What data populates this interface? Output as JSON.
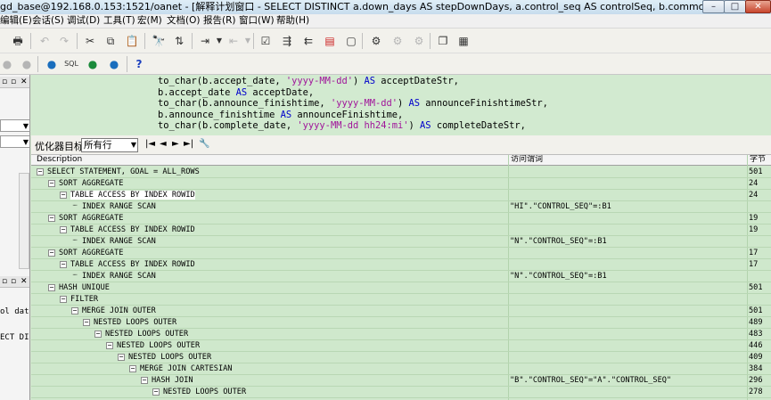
{
  "window": {
    "title": "gd_base@192.168.0.153:1521/oanet - [解释计划窗口 - SELECT DISTINCT a.down_days AS stepDownDays, a.control_seq AS controlSeq, b.common_code, to_ch]",
    "minimize": "–",
    "maximize": "□",
    "close": "✕"
  },
  "menu": [
    "编辑(E)",
    "会话(S)",
    "调试(D)",
    "工具(T)",
    "宏(M)",
    "文档(O)",
    "报告(R)",
    "窗口(W)",
    "帮助(H)"
  ],
  "icons": {
    "toolbar1": [
      "print-icon",
      "undo-icon",
      "redo-icon",
      "cut-icon",
      "copy-icon",
      "paste-icon",
      "find-icon",
      "replace-icon",
      "import-icon",
      "export-icon",
      "describe-icon",
      "indent-icon",
      "unindent-icon",
      "comment-icon",
      "uncomment-icon",
      "debug-icon",
      "step-icon",
      "step-over-icon",
      "window-icon",
      "tile-icon"
    ],
    "toolbar2": [
      "connect-icon",
      "disconnect-icon",
      "session-icon",
      "sql-icon",
      "commit-icon",
      "rollback-icon",
      "help-icon"
    ]
  },
  "left_panel": {
    "combo1": "",
    "combo2": "",
    "text1": "ol date:",
    "text2": "ECT DISTI"
  },
  "sql": [
    [
      {
        "t": "to_char(b.accept_date, ",
        "c": "plain"
      },
      {
        "t": "'yyyy-MM-dd'",
        "c": "str"
      },
      {
        "t": ") ",
        "c": "plain"
      },
      {
        "t": "AS",
        "c": "kw"
      },
      {
        "t": " acceptDateStr,",
        "c": "plain"
      }
    ],
    [
      {
        "t": "b.accept_date ",
        "c": "plain"
      },
      {
        "t": "AS",
        "c": "kw"
      },
      {
        "t": " acceptDate,",
        "c": "plain"
      }
    ],
    [
      {
        "t": "to_char(b.announce_finishtime, ",
        "c": "plain"
      },
      {
        "t": "'yyyy-MM-dd'",
        "c": "str"
      },
      {
        "t": ") ",
        "c": "plain"
      },
      {
        "t": "AS",
        "c": "kw"
      },
      {
        "t": " announceFinishtimeStr,",
        "c": "plain"
      }
    ],
    [
      {
        "t": "b.announce_finishtime ",
        "c": "plain"
      },
      {
        "t": "AS",
        "c": "kw"
      },
      {
        "t": " announceFinishtime,",
        "c": "plain"
      }
    ],
    [
      {
        "t": "to_char(b.complete_date, ",
        "c": "plain"
      },
      {
        "t": "'yyyy-MM-dd hh24:mi'",
        "c": "str"
      },
      {
        "t": ") ",
        "c": "plain"
      },
      {
        "t": "AS",
        "c": "kw"
      },
      {
        "t": " completeDateStr,",
        "c": "plain"
      }
    ]
  ],
  "optimizer": {
    "label": "优化器目标",
    "value": "所有行",
    "nav": [
      "|◄",
      "◄",
      "►",
      "►|",
      "🔧"
    ]
  },
  "grid": {
    "columns": [
      "Description",
      "访问谓词",
      "字节"
    ],
    "rows": [
      {
        "depth": 0,
        "desc": "SELECT STATEMENT, GOAL = ALL_ROWS",
        "pred": "",
        "bytes": "501",
        "node": "minus"
      },
      {
        "depth": 1,
        "desc": "SORT AGGREGATE",
        "pred": "",
        "bytes": "24",
        "node": "minus"
      },
      {
        "depth": 2,
        "desc": "TABLE ACCESS BY INDEX ROWID",
        "pred": "",
        "bytes": "24",
        "node": "minus",
        "selected": true
      },
      {
        "depth": 3,
        "desc": "INDEX RANGE SCAN",
        "pred": "\"HI\".\"CONTROL_SEQ\"=:B1",
        "bytes": "",
        "node": "leaf"
      },
      {
        "depth": 1,
        "desc": "SORT AGGREGATE",
        "pred": "",
        "bytes": "19",
        "node": "minus"
      },
      {
        "depth": 2,
        "desc": "TABLE ACCESS BY INDEX ROWID",
        "pred": "",
        "bytes": "19",
        "node": "minus"
      },
      {
        "depth": 3,
        "desc": "INDEX RANGE SCAN",
        "pred": "\"N\".\"CONTROL_SEQ\"=:B1",
        "bytes": "",
        "node": "leaf"
      },
      {
        "depth": 1,
        "desc": "SORT AGGREGATE",
        "pred": "",
        "bytes": "17",
        "node": "minus"
      },
      {
        "depth": 2,
        "desc": "TABLE ACCESS BY INDEX ROWID",
        "pred": "",
        "bytes": "17",
        "node": "minus"
      },
      {
        "depth": 3,
        "desc": "INDEX RANGE SCAN",
        "pred": "\"N\".\"CONTROL_SEQ\"=:B1",
        "bytes": "",
        "node": "leaf"
      },
      {
        "depth": 1,
        "desc": "HASH UNIQUE",
        "pred": "",
        "bytes": "501",
        "node": "minus"
      },
      {
        "depth": 2,
        "desc": "FILTER",
        "pred": "",
        "bytes": "",
        "node": "minus"
      },
      {
        "depth": 3,
        "desc": "MERGE JOIN OUTER",
        "pred": "",
        "bytes": "501",
        "node": "minus"
      },
      {
        "depth": 4,
        "desc": "NESTED LOOPS OUTER",
        "pred": "",
        "bytes": "489",
        "node": "minus"
      },
      {
        "depth": 5,
        "desc": "NESTED LOOPS OUTER",
        "pred": "",
        "bytes": "483",
        "node": "minus"
      },
      {
        "depth": 6,
        "desc": "NESTED LOOPS OUTER",
        "pred": "",
        "bytes": "446",
        "node": "minus"
      },
      {
        "depth": 7,
        "desc": "NESTED LOOPS OUTER",
        "pred": "",
        "bytes": "409",
        "node": "minus"
      },
      {
        "depth": 8,
        "desc": "MERGE JOIN CARTESIAN",
        "pred": "",
        "bytes": "384",
        "node": "minus"
      },
      {
        "depth": 9,
        "desc": "HASH JOIN",
        "pred": "\"B\".\"CONTROL_SEQ\"=\"A\".\"CONTROL_SEQ\"",
        "bytes": "296",
        "node": "minus"
      },
      {
        "depth": 10,
        "desc": "NESTED LOOPS OUTER",
        "pred": "",
        "bytes": "278",
        "node": "minus"
      }
    ]
  }
}
